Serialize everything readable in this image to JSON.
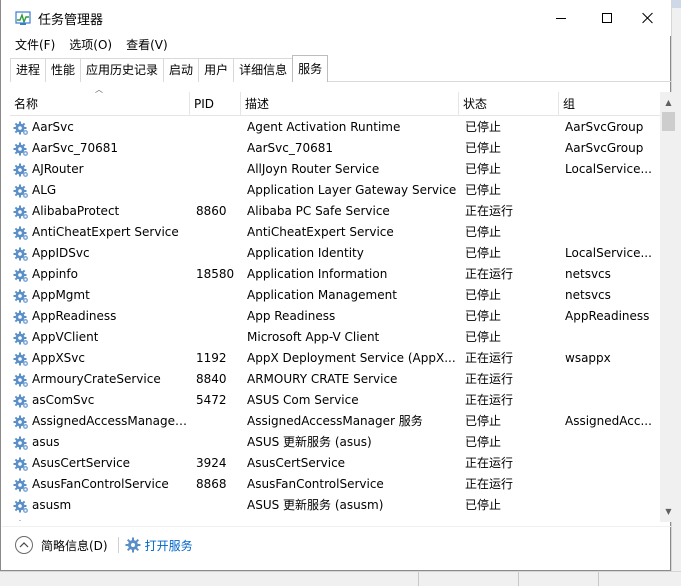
{
  "window": {
    "title": "任务管理器",
    "minimize_label": "最小化",
    "maximize_label": "最大化",
    "close_label": "关闭"
  },
  "menu": [
    "文件(F)",
    "选项(O)",
    "查看(V)"
  ],
  "tabs": [
    {
      "label": "进程",
      "active": false
    },
    {
      "label": "性能",
      "active": false
    },
    {
      "label": "应用历史记录",
      "active": false
    },
    {
      "label": "启动",
      "active": false
    },
    {
      "label": "用户",
      "active": false
    },
    {
      "label": "详细信息",
      "active": false
    },
    {
      "label": "服务",
      "active": true
    }
  ],
  "columns": {
    "name": "名称",
    "pid": "PID",
    "desc": "描述",
    "status": "状态",
    "group": "组"
  },
  "services": [
    {
      "name": "AarSvc",
      "pid": "",
      "desc": "Agent Activation Runtime",
      "status": "已停止",
      "group": "AarSvcGroup"
    },
    {
      "name": "AarSvc_70681",
      "pid": "",
      "desc": "AarSvc_70681",
      "status": "已停止",
      "group": "AarSvcGroup"
    },
    {
      "name": "AJRouter",
      "pid": "",
      "desc": "AllJoyn Router Service",
      "status": "已停止",
      "group": "LocalService..."
    },
    {
      "name": "ALG",
      "pid": "",
      "desc": "Application Layer Gateway Service",
      "status": "已停止",
      "group": ""
    },
    {
      "name": "AlibabaProtect",
      "pid": "8860",
      "desc": "Alibaba PC Safe Service",
      "status": "正在运行",
      "group": ""
    },
    {
      "name": "AntiCheatExpert Service",
      "pid": "",
      "desc": "AntiCheatExpert Service",
      "status": "已停止",
      "group": ""
    },
    {
      "name": "AppIDSvc",
      "pid": "",
      "desc": "Application Identity",
      "status": "已停止",
      "group": "LocalService..."
    },
    {
      "name": "Appinfo",
      "pid": "18580",
      "desc": "Application Information",
      "status": "正在运行",
      "group": "netsvcs"
    },
    {
      "name": "AppMgmt",
      "pid": "",
      "desc": "Application Management",
      "status": "已停止",
      "group": "netsvcs"
    },
    {
      "name": "AppReadiness",
      "pid": "",
      "desc": "App Readiness",
      "status": "已停止",
      "group": "AppReadiness"
    },
    {
      "name": "AppVClient",
      "pid": "",
      "desc": "Microsoft App-V Client",
      "status": "已停止",
      "group": ""
    },
    {
      "name": "AppXSvc",
      "pid": "1192",
      "desc": "AppX Deployment Service (AppX...",
      "status": "正在运行",
      "group": "wsappx"
    },
    {
      "name": "ArmouryCrateService",
      "pid": "8840",
      "desc": "ARMOURY CRATE Service",
      "status": "正在运行",
      "group": ""
    },
    {
      "name": "asComSvc",
      "pid": "5472",
      "desc": "ASUS Com Service",
      "status": "正在运行",
      "group": ""
    },
    {
      "name": "AssignedAccessManager...",
      "pid": "",
      "desc": "AssignedAccessManager 服务",
      "status": "已停止",
      "group": "AssignedAcc..."
    },
    {
      "name": "asus",
      "pid": "",
      "desc": "ASUS 更新服务 (asus)",
      "status": "已停止",
      "group": ""
    },
    {
      "name": "AsusCertService",
      "pid": "3924",
      "desc": "AsusCertService",
      "status": "正在运行",
      "group": ""
    },
    {
      "name": "AsusFanControlService",
      "pid": "8868",
      "desc": "AsusFanControlService",
      "status": "正在运行",
      "group": ""
    },
    {
      "name": "asusm",
      "pid": "",
      "desc": "ASUS 更新服务 (asusm)",
      "status": "已停止",
      "group": ""
    }
  ],
  "footer": {
    "less_details": "简略信息(D)",
    "open_services": "打开服务"
  },
  "icons": {
    "app": "task-manager-icon",
    "service": "gear-icon",
    "collapse": "chevron-up-circle-icon",
    "sort": "sort-ascending-icon"
  },
  "colors": {
    "link": "#0066cc",
    "gear": "#5b8fc7"
  }
}
